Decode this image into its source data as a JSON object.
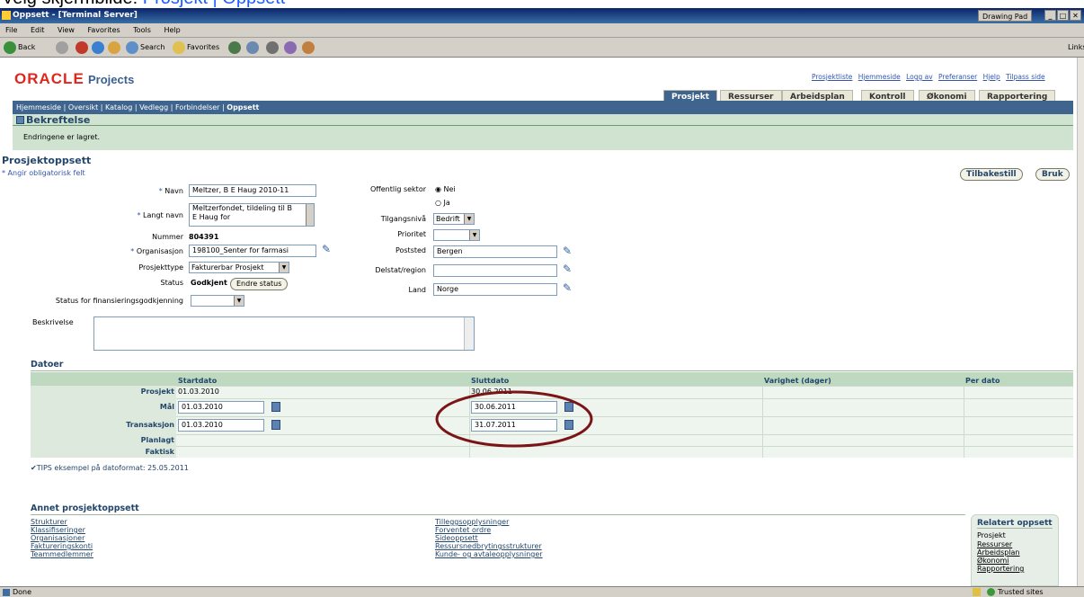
{
  "slide_caption": {
    "prefix": "Velg skjermbilde: ",
    "link": "Prosjekt | Oppsett"
  },
  "window": {
    "title": "Oppsett - [Terminal Server]",
    "drawing_pad": "Drawing Pad"
  },
  "menu": [
    "File",
    "Edit",
    "View",
    "Favorites",
    "Tools",
    "Help"
  ],
  "toolbar": {
    "back": "Back",
    "search": "Search",
    "favorites": "Favorites",
    "links": "Links"
  },
  "app": {
    "brand": "ORACLE",
    "product": "Projects",
    "global_links": [
      "Prosjektliste",
      "Hjemmeside",
      "Logg av",
      "Preferanser",
      "Hjelp",
      "Tilpass side"
    ],
    "tabs": [
      "Prosjekt",
      "Ressurser",
      "Arbeidsplan",
      "Kontroll",
      "Økonomi",
      "Rapportering"
    ],
    "active_tab": "Prosjekt",
    "subnav": [
      "Hjemmeside",
      "Oversikt",
      "Katalog",
      "Vedlegg",
      "Forbindelser",
      "Oppsett"
    ],
    "active_subnav": "Oppsett"
  },
  "confirmation": {
    "title": "Bekreftelse",
    "message": "Endringene er lagret."
  },
  "setup": {
    "title": "Prosjektoppsett",
    "required_note": "* Angir obligatorisk felt",
    "reset_button": "Tilbakestill",
    "apply_button": "Bruk",
    "name_label": "Navn",
    "name_value": "Meltzer, B E Haug 2010-11",
    "long_name_label": "Langt navn",
    "long_name_line1": "Meltzerfondet, tildeling til B",
    "long_name_line2": "E Haug for",
    "number_label": "Nummer",
    "number_value": "804391",
    "org_label": "Organisasjon",
    "org_value": "198100_Senter for farmasi",
    "type_label": "Prosjekttype",
    "type_value": "Fakturerbar Prosjekt",
    "status_label": "Status",
    "status_value": "Godkjent",
    "change_status_button": "Endre status",
    "funding_label": "Status for finansieringsgodkjenning",
    "funding_value": "",
    "public_label": "Offentlig sektor",
    "public_no": "Nei",
    "public_yes": "Ja",
    "public_selected": "Nei",
    "access_label": "Tilgangsnivå",
    "access_value": "Bedrift",
    "priority_label": "Prioritet",
    "priority_value": "",
    "city_label": "Poststed",
    "city_value": "Bergen",
    "state_label": "Delstat/region",
    "state_value": "",
    "country_label": "Land",
    "country_value": "Norge",
    "description_label": "Beskrivelse",
    "description_value": ""
  },
  "dates": {
    "title": "Datoer",
    "headers": [
      "Startdato",
      "Sluttdato",
      "Varighet (dager)",
      "Per dato"
    ],
    "rows": [
      {
        "label": "Prosjekt",
        "start": "01.03.2010",
        "end": "30.06.2011",
        "editable": false
      },
      {
        "label": "Mål",
        "start": "01.03.2010",
        "end": "30.06.2011",
        "editable": true
      },
      {
        "label": "Transaksjon",
        "start": "01.03.2010",
        "end": "31.07.2011",
        "editable": true
      },
      {
        "label": "Planlagt",
        "start": "",
        "end": "",
        "editable": false
      },
      {
        "label": "Faktisk",
        "start": "",
        "end": "",
        "editable": false
      }
    ],
    "tip": "TIPS eksempel på datoformat: 25.05.2011"
  },
  "other_setup": {
    "title": "Annet prosjektoppsett",
    "col1": [
      "Strukturer",
      "Klassifiseringer",
      "Organisasjoner",
      "Faktureringskonti",
      "Teammedlemmer"
    ],
    "col2": [
      "Tilleggsopplysninger",
      "Forventet ordre",
      "Sideoppsett",
      "Ressursnedbrytingsstrukturer",
      "Kunde- og avtaleopplysninger"
    ]
  },
  "related": {
    "title": "Relatert oppsett",
    "plain": "Prosjekt",
    "links": [
      "Ressurser",
      "Arbeidsplan",
      "Økonomi",
      "Rapportering"
    ]
  },
  "status": {
    "left": "Done",
    "zone": "Trusted sites"
  },
  "colors": {
    "oracle_red": "#e1261c",
    "nav_blue": "#3f658f",
    "confirm_green": "#cfe3d0",
    "annotation": "#7a1416"
  }
}
